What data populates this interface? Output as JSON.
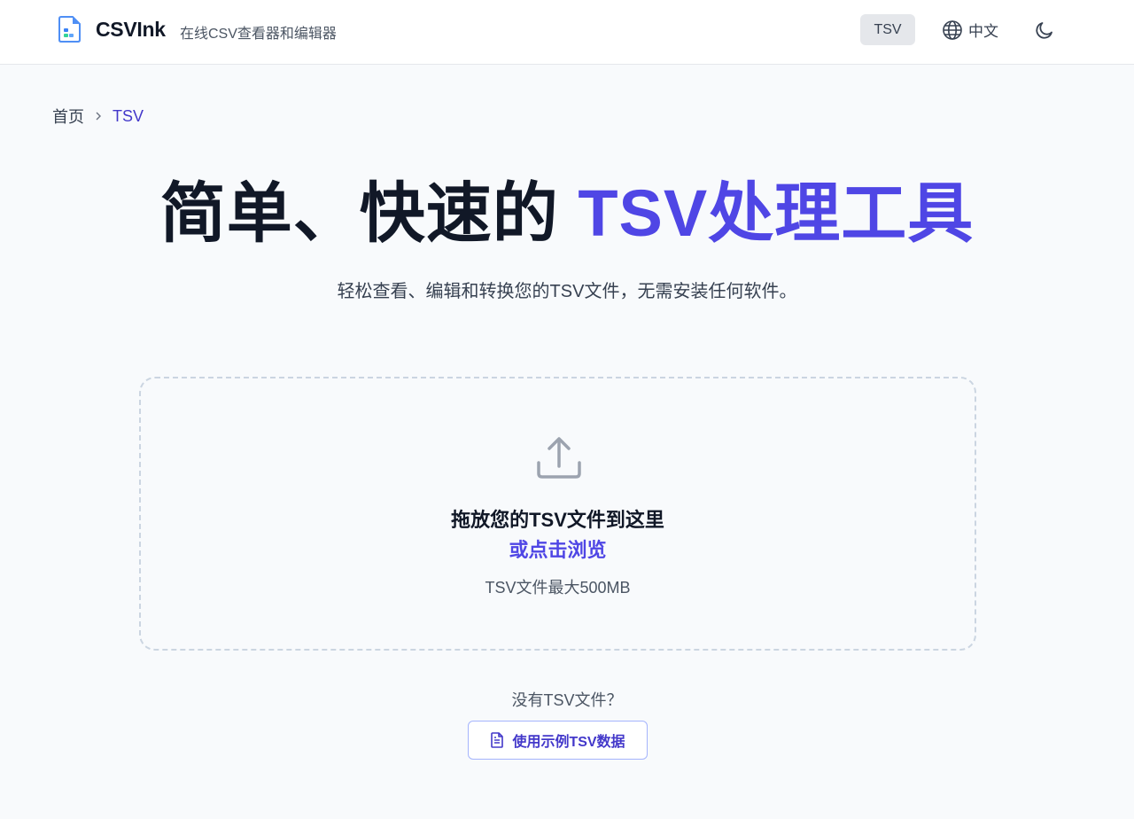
{
  "header": {
    "brand": "CSVInk",
    "tagline": "在线CSV查看器和编辑器",
    "tsv_label": "TSV",
    "language_label": "中文"
  },
  "breadcrumb": {
    "home": "首页",
    "current": "TSV"
  },
  "hero": {
    "title_plain": "简单、快速的",
    "title_accent": "TSV处理工具",
    "subtitle": "轻松查看、编辑和转换您的TSV文件，无需安装任何软件。"
  },
  "dropzone": {
    "title": "拖放您的TSV文件到这里",
    "browse": "或点击浏览",
    "limit": "TSV文件最大500MB"
  },
  "sample": {
    "prompt": "没有TSV文件？",
    "button_label": "使用示例TSV数据"
  },
  "colors": {
    "accent": "#4f46e5",
    "accent_dark": "#4338ca",
    "text": "#111827",
    "muted": "#4b5563",
    "background": "#f8fafc"
  },
  "icons": {
    "logo": "file-spreadsheet-logo-icon",
    "language": "globe-icon",
    "theme": "moon-icon",
    "breadcrumb_separator": "chevron-right-icon",
    "upload": "upload-icon",
    "sample": "document-icon"
  }
}
